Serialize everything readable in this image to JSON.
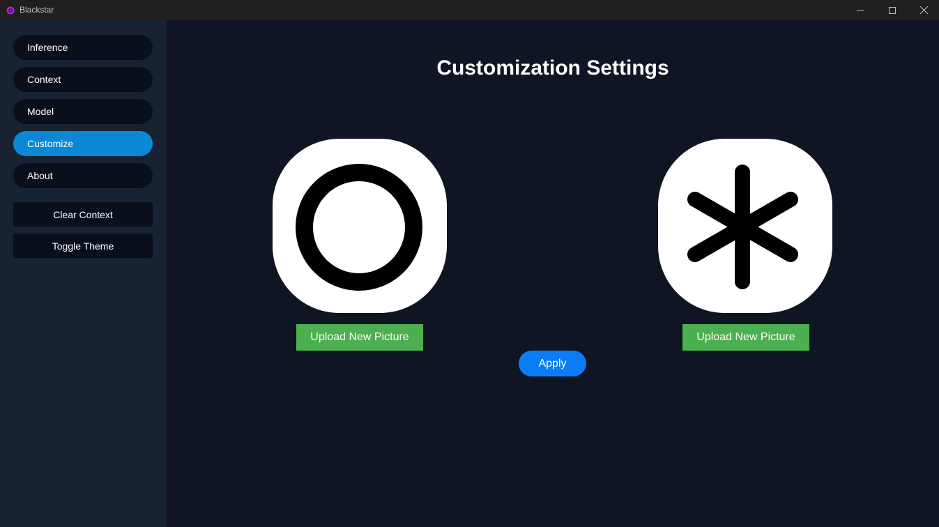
{
  "window": {
    "title": "Blackstar",
    "icon": "blackstar-app-icon",
    "accent_icon_color": "#b01fd8"
  },
  "sidebar": {
    "nav_items": [
      {
        "label": "Inference",
        "active": false
      },
      {
        "label": "Context",
        "active": false
      },
      {
        "label": "Model",
        "active": false
      },
      {
        "label": "Customize",
        "active": true
      },
      {
        "label": "About",
        "active": false
      }
    ],
    "actions": [
      {
        "label": "Clear Context"
      },
      {
        "label": "Toggle Theme"
      }
    ]
  },
  "main": {
    "title": "Customization Settings",
    "avatars": [
      {
        "icon": "ring-icon",
        "upload_label": "Upload New Picture"
      },
      {
        "icon": "asterisk-icon",
        "upload_label": "Upload New Picture"
      }
    ],
    "apply_label": "Apply"
  },
  "colors": {
    "active_nav": "#0a88d6",
    "upload_button": "#4caf50",
    "apply_button": "#0a7cf5",
    "background": "#0f1523",
    "sidebar": "#172333"
  }
}
